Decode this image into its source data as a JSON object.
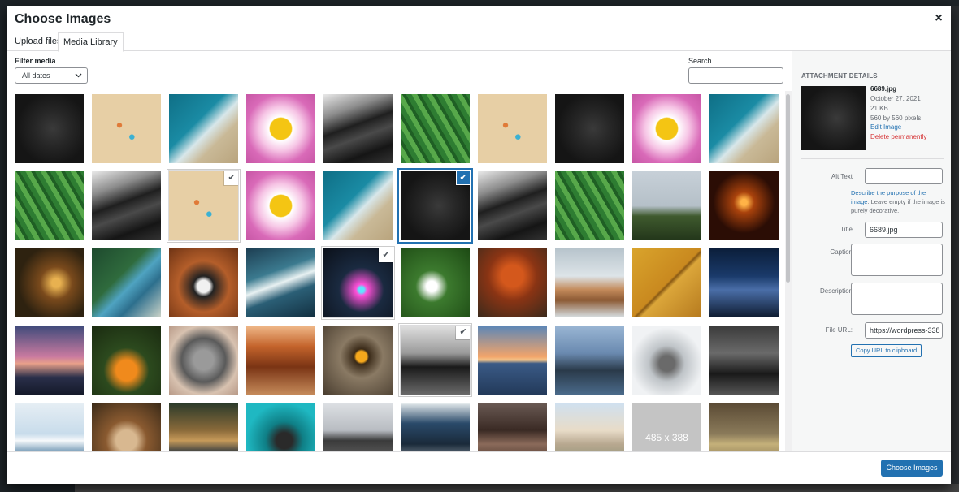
{
  "modal": {
    "title": "Choose Images",
    "close_symbol": "×"
  },
  "tabs": [
    {
      "label": "Upload files",
      "active": false
    },
    {
      "label": "Media Library",
      "active": true
    }
  ],
  "filter": {
    "label": "Filter media",
    "date_value": "All dates"
  },
  "search": {
    "label": "Search",
    "value": ""
  },
  "grid": {
    "items": [
      {
        "img": "img-dog",
        "state": ""
      },
      {
        "img": "img-beach",
        "state": ""
      },
      {
        "img": "img-ocean",
        "state": ""
      },
      {
        "img": "img-daisy",
        "state": ""
      },
      {
        "img": "img-dunes",
        "state": ""
      },
      {
        "img": "img-leaves",
        "state": ""
      },
      {
        "img": "img-beach",
        "state": ""
      },
      {
        "img": "img-dog",
        "state": ""
      },
      {
        "img": "img-daisy",
        "state": ""
      },
      {
        "img": "img-ocean",
        "state": ""
      },
      {
        "img": "img-leaves",
        "state": ""
      },
      {
        "img": "img-dunes",
        "state": ""
      },
      {
        "img": "img-beach",
        "state": "selected"
      },
      {
        "img": "img-daisy",
        "state": ""
      },
      {
        "img": "img-ocean",
        "state": ""
      },
      {
        "img": "img-dog",
        "state": "focused"
      },
      {
        "img": "img-dunes",
        "state": ""
      },
      {
        "img": "img-leaves",
        "state": ""
      },
      {
        "img": "img-car",
        "state": ""
      },
      {
        "img": "img-sunset1",
        "state": ""
      },
      {
        "img": "img-forest",
        "state": ""
      },
      {
        "img": "img-aerial",
        "state": ""
      },
      {
        "img": "img-doggy",
        "state": ""
      },
      {
        "img": "img-wave",
        "state": ""
      },
      {
        "img": "img-neon",
        "state": "selected"
      },
      {
        "img": "img-house",
        "state": ""
      },
      {
        "img": "img-autumn",
        "state": ""
      },
      {
        "img": "img-boats",
        "state": ""
      },
      {
        "img": "img-leaf",
        "state": ""
      },
      {
        "img": "img-city",
        "state": ""
      },
      {
        "img": "img-dusk",
        "state": ""
      },
      {
        "img": "img-pumpkin",
        "state": ""
      },
      {
        "img": "img-cat",
        "state": ""
      },
      {
        "img": "img-canyon",
        "state": ""
      },
      {
        "img": "img-owl",
        "state": ""
      },
      {
        "img": "img-kart",
        "state": "selected"
      },
      {
        "img": "img-sea-sunset",
        "state": ""
      },
      {
        "img": "img-hills",
        "state": ""
      },
      {
        "img": "img-snow",
        "state": ""
      },
      {
        "img": "img-street",
        "state": ""
      },
      {
        "img": "img-ice",
        "state": ""
      },
      {
        "img": "img-cow",
        "state": ""
      },
      {
        "img": "img-lake",
        "state": ""
      },
      {
        "img": "img-hood",
        "state": ""
      },
      {
        "img": "img-moto",
        "state": ""
      },
      {
        "img": "img-laptop",
        "state": ""
      },
      {
        "img": "img-alley",
        "state": ""
      },
      {
        "img": "img-bldg",
        "state": ""
      },
      {
        "img": "img-grey",
        "state": "",
        "text": "485 x 388"
      },
      {
        "img": "img-storm",
        "state": ""
      }
    ],
    "check_symbol": "✔"
  },
  "details": {
    "heading": "ATTACHMENT DETAILS",
    "file_name": "6689.jpg",
    "date": "October 27, 2021",
    "size": "21 KB",
    "dimensions": "560 by 560 pixels",
    "edit_link": "Edit Image",
    "delete_link": "Delete permanently",
    "alt_label": "Alt Text",
    "alt_value": "",
    "alt_help_link": "Describe the purpose of the image",
    "alt_help_rest": ". Leave empty if the image is purely decorative.",
    "title_label": "Title",
    "title_value": "6689.jpg",
    "caption_label": "Caption",
    "description_label": "Description",
    "url_label": "File URL:",
    "url_value": "https://wordpress-338",
    "copy_button": "Copy URL to clipboard"
  },
  "toolbar": {
    "primary_label": "Choose Images"
  }
}
